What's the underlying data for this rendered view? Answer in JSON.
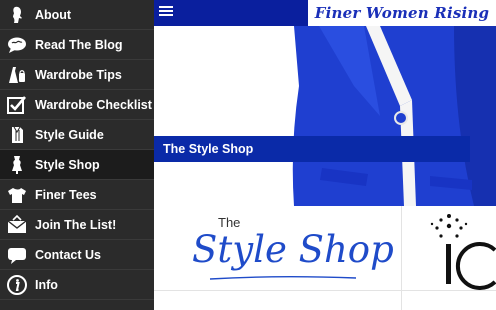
{
  "sidebar": {
    "items": [
      {
        "label": "About",
        "icon": "woman-silhouette-icon"
      },
      {
        "label": "Read The Blog",
        "icon": "speech-bubble-icon"
      },
      {
        "label": "Wardrobe Tips",
        "icon": "dress-icon"
      },
      {
        "label": "Wardrobe Checklist",
        "icon": "checkbox-icon"
      },
      {
        "label": "Style Guide",
        "icon": "book-icon"
      },
      {
        "label": "Style Shop",
        "icon": "dress-form-icon",
        "active": true
      },
      {
        "label": "Finer Tees",
        "icon": "tshirt-icon"
      },
      {
        "label": "Join The List!",
        "icon": "envelope-icon"
      },
      {
        "label": "Contact Us",
        "icon": "chat-bubble-icon"
      },
      {
        "label": "Info",
        "icon": "info-icon"
      }
    ]
  },
  "header": {
    "brand": "Finer Women Rising",
    "menu_icon": "hamburger-icon"
  },
  "hero": {
    "banner_title": "The Style Shop"
  },
  "cards": {
    "logo_small": "The",
    "logo_script": "Style Shop",
    "second_card_text": "IC"
  },
  "colors": {
    "sidebar_bg": "#2b2b2b",
    "topbar_blue": "#0a1f9e",
    "brand_text": "#1a2fb8",
    "banner_blue": "#0a2aa8",
    "jacket_blue": "#1f3fd0",
    "logo_blue": "#1f4bc9"
  }
}
